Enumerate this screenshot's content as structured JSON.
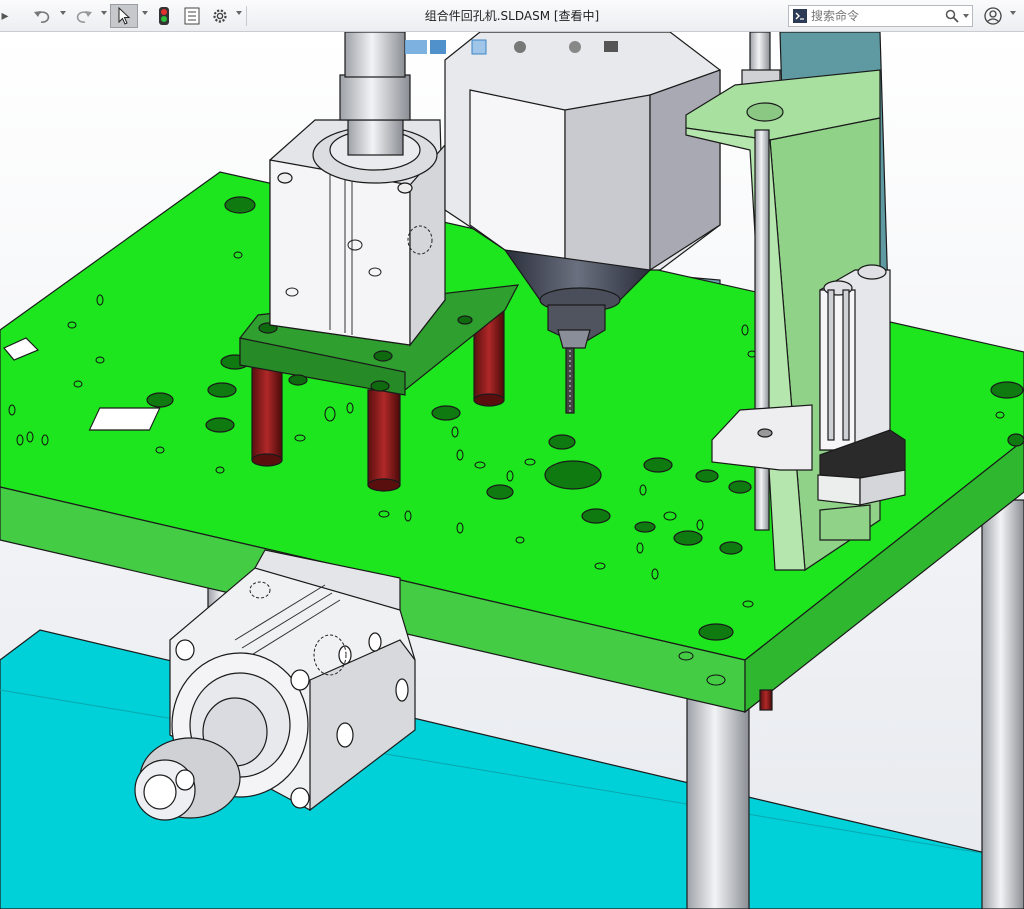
{
  "window": {
    "title": "组合件回孔机.SLDASM [查看中]"
  },
  "toolbar": {
    "buttons": [
      {
        "name": "undo-button",
        "icon": "undo-icon"
      },
      {
        "name": "redo-button",
        "icon": "redo-icon"
      },
      {
        "name": "select-button",
        "icon": "cursor-icon",
        "active": true
      },
      {
        "name": "rebuild-button",
        "icon": "traffic-light-icon"
      },
      {
        "name": "file-properties-button",
        "icon": "properties-icon"
      },
      {
        "name": "options-button",
        "icon": "gear-icon"
      }
    ]
  },
  "search": {
    "placeholder": "搜索命令",
    "icon": "search-icon"
  },
  "account": {
    "icon": "user-icon"
  },
  "viewport": {
    "description_colors": {
      "plate": "#1ee61e",
      "plate_edge": "#3ec43e",
      "mount_plate": "#2fa02f",
      "bracket": "#a8e0a0",
      "floor": "#00d0d8",
      "pillar": "#8b1e1e",
      "steel": "#d9dadd"
    },
    "heads_up_toolbar_icons": [
      "view-orientation-icon",
      "display-style-icon",
      "hide-show-icon",
      "appearance-icon",
      "scene-icon",
      "view-settings-icon"
    ]
  }
}
